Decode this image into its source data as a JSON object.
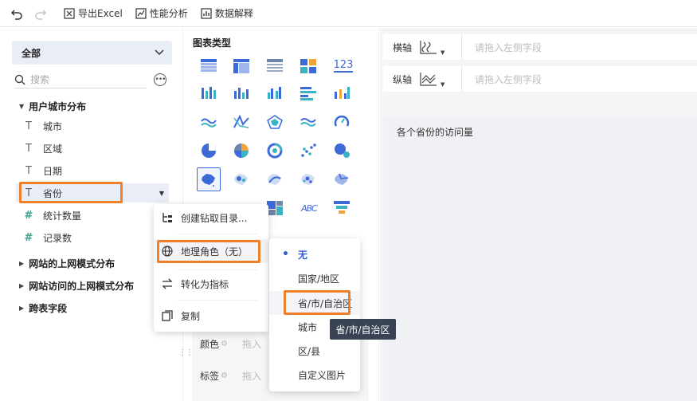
{
  "toolbar": {
    "undo_icon": "undo-icon",
    "redo_icon": "redo-icon",
    "export_label": "导出Excel",
    "perf_label": "性能分析",
    "explain_label": "数据解释"
  },
  "left": {
    "select_label": "全部",
    "search_placeholder": "搜索",
    "groups": [
      {
        "label": "用户城市分布",
        "expanded": true
      },
      {
        "label": "网站的上网模式分布",
        "expanded": false
      },
      {
        "label": "网站访问的上网模式分布",
        "expanded": false
      },
      {
        "label": "跨表字段",
        "expanded": false
      }
    ],
    "fields": [
      {
        "label": "城市",
        "type": "text"
      },
      {
        "label": "区域",
        "type": "text"
      },
      {
        "label": "日期",
        "type": "text"
      },
      {
        "label": "省份",
        "type": "text"
      },
      {
        "label": "统计数量",
        "type": "number"
      },
      {
        "label": "记录数",
        "type": "number"
      }
    ]
  },
  "mid": {
    "title": "图表类型",
    "number_card_text": "123",
    "word_cloud_text": "ABC",
    "marks": [
      {
        "label": "颜色",
        "hint": "拖入"
      },
      {
        "label": "标签",
        "hint": "拖入"
      }
    ]
  },
  "right": {
    "x_axis_label": "横轴",
    "y_axis_label": "纵轴",
    "x_hint": "请拖入左侧字段",
    "y_hint": "请拖入左侧字段",
    "canvas_title": "各个省份的访问量"
  },
  "context_menu": {
    "items": [
      {
        "label": "创建钻取目录..."
      },
      {
        "label": "地理角色（无）"
      },
      {
        "label": "转化为指标"
      },
      {
        "label": "复制"
      }
    ]
  },
  "geo_submenu": {
    "items": [
      {
        "label": "无",
        "active": true
      },
      {
        "label": "国家/地区",
        "active": false
      },
      {
        "label": "省/市/自治区",
        "active": false
      },
      {
        "label": "城市",
        "active": false
      },
      {
        "label": "区/县",
        "active": false
      },
      {
        "label": "自定义图片",
        "active": false
      }
    ]
  },
  "tooltip": {
    "text": "省/市/自治区"
  },
  "colors": {
    "accent": "#3c6bd8",
    "highlight_border": "#f07f2a",
    "tooltip_bg": "#3a4354",
    "field_number": "#3a9f8b"
  }
}
